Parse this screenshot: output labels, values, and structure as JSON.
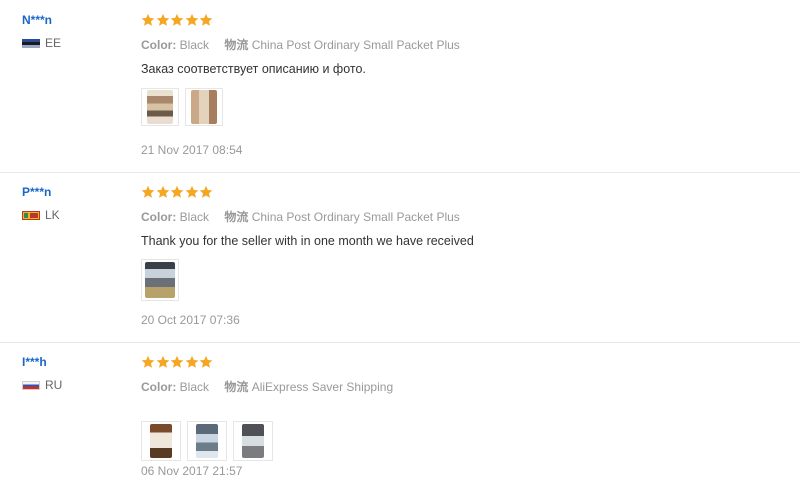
{
  "reviews": [
    {
      "user": "N***n",
      "country": "EE",
      "rating": 5,
      "color_label": "Color:",
      "color_value": "Black",
      "shipping_label": "物流",
      "shipping_value": "China Post Ordinary Small Packet Plus",
      "text": "Заказ соответствует описанию и фото.",
      "photo_count": 2,
      "date": "21 Nov 2017 08:54"
    },
    {
      "user": "P***n",
      "country": "LK",
      "rating": 5,
      "color_label": "Color:",
      "color_value": "Black",
      "shipping_label": "物流",
      "shipping_value": "China Post Ordinary Small Packet Plus",
      "text": "Thank you for the seller with in one month we have received",
      "photo_count": 1,
      "date": "20 Oct 2017 07:36"
    },
    {
      "user": "I***h",
      "country": "RU",
      "rating": 5,
      "color_label": "Color:",
      "color_value": "Black",
      "shipping_label": "物流",
      "shipping_value": "AliExpress Saver Shipping",
      "text": "",
      "photo_count": 3,
      "date": "06 Nov 2017 21:57"
    }
  ],
  "colors": {
    "star": "#f5a623",
    "username": "#1a66c7",
    "meta": "#999999"
  },
  "icons": {
    "star": "star-icon",
    "flag_ee": "flag-ee-icon",
    "flag_lk": "flag-lk-icon",
    "flag_ru": "flag-ru-icon"
  }
}
